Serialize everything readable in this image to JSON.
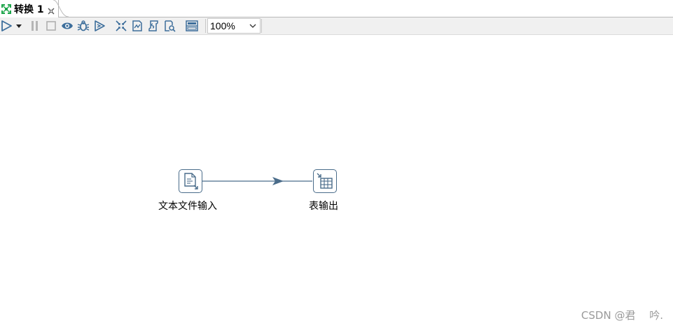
{
  "tab": {
    "title": "转换 1",
    "icon": "transformation-icon",
    "close_icon": "close-icon"
  },
  "toolbar": {
    "buttons": [
      {
        "name": "run-button",
        "icon": "play-icon"
      },
      {
        "name": "run-options-dropdown",
        "icon": "dropdown-arrow-icon"
      },
      {
        "name": "pause-button",
        "icon": "pause-icon"
      },
      {
        "name": "stop-button",
        "icon": "stop-icon"
      },
      {
        "name": "preview-button",
        "icon": "eye-icon"
      },
      {
        "name": "debug-button",
        "icon": "bug-icon"
      },
      {
        "name": "replay-button",
        "icon": "replay-icon"
      },
      {
        "name": "verify-button",
        "icon": "verify-icon"
      },
      {
        "name": "impact-analysis-button",
        "icon": "impact-icon"
      },
      {
        "name": "sql-button",
        "icon": "sql-script-icon"
      },
      {
        "name": "explore-db-button",
        "icon": "db-explore-icon"
      },
      {
        "name": "show-results-button",
        "icon": "results-panel-icon"
      }
    ],
    "zoom": {
      "value": "100%"
    }
  },
  "canvas": {
    "steps": [
      {
        "label": "文本文件输入",
        "icon": "text-file-input-icon"
      },
      {
        "label": "表输出",
        "icon": "table-output-icon"
      }
    ],
    "hop_color": "#4a6c8a"
  },
  "watermark": "CSDN @君　 吟."
}
